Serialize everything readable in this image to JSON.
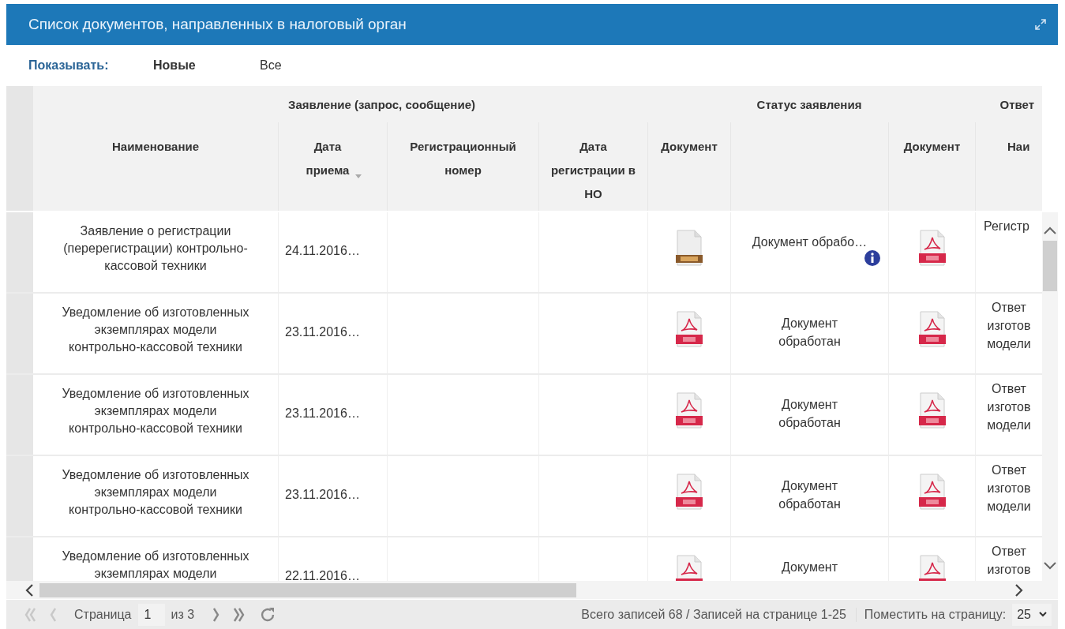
{
  "panel": {
    "title": "Список документов, направленных в налоговый орган"
  },
  "filter": {
    "label": "Показывать:",
    "options": [
      {
        "label": "Новые",
        "selected": true
      },
      {
        "label": "Все",
        "selected": false
      }
    ]
  },
  "table": {
    "groups": [
      {
        "label": "Заявление (запрос, сообщение)"
      },
      {
        "label": "Статус заявления"
      },
      {
        "label": "Ответ"
      }
    ],
    "columns": [
      {
        "label": "Наименование",
        "sorted": false
      },
      {
        "label": "Дата приема",
        "sorted": true
      },
      {
        "label": "Регистрационный номер",
        "sorted": false
      },
      {
        "label": "Дата регистрации в НО",
        "sorted": false
      },
      {
        "label": "Документ",
        "sorted": false
      },
      {
        "label": "Документ",
        "sorted": false
      },
      {
        "label": "Наи",
        "sorted": false
      }
    ],
    "rows": [
      {
        "name": "Заявление о регистрации (перерегистрации) контрольно-кассовой техники",
        "date": "24.11.2016…",
        "document": {
          "kind": "zip"
        },
        "status": "Документ обрабо…",
        "status_info": true,
        "answer_document": {
          "kind": "pdf"
        },
        "answer": "Регистр"
      },
      {
        "name": "Уведомление об изготовленных экземплярах модели контрольно-кассовой техники",
        "date": "23.11.2016…",
        "document": {
          "kind": "pdf"
        },
        "status": "Документ обработан",
        "status_info": false,
        "answer_document": {
          "kind": "pdf"
        },
        "answer": "Ответ изготов модели"
      },
      {
        "name": "Уведомление об изготовленных экземплярах модели контрольно-кассовой техники",
        "date": "23.11.2016…",
        "document": {
          "kind": "pdf"
        },
        "status": "Документ обработан",
        "status_info": false,
        "answer_document": {
          "kind": "pdf"
        },
        "answer": "Ответ изготов модели"
      },
      {
        "name": "Уведомление об изготовленных экземплярах модели контрольно-кассовой техники",
        "date": "23.11.2016…",
        "document": {
          "kind": "pdf"
        },
        "status": "Документ обработан",
        "status_info": false,
        "answer_document": {
          "kind": "pdf"
        },
        "answer": "Ответ изготов модели"
      },
      {
        "name": "Уведомление об изготовленных экземплярах модели",
        "date": "22.11.2016…",
        "document": {
          "kind": "pdf"
        },
        "status": "Документ",
        "status_info": false,
        "answer_document": {
          "kind": "pdf"
        },
        "answer": "Ответ изготов"
      }
    ]
  },
  "pager": {
    "first_disabled": true,
    "prev_disabled": true,
    "page_label": "Страница",
    "page": "1",
    "of": "из 3",
    "next_disabled": false,
    "last_disabled": false,
    "summary": "Всего записей 68 / Записей на странице 1-25",
    "per_page_label": "Поместить на страницу:",
    "per_page": "25"
  }
}
